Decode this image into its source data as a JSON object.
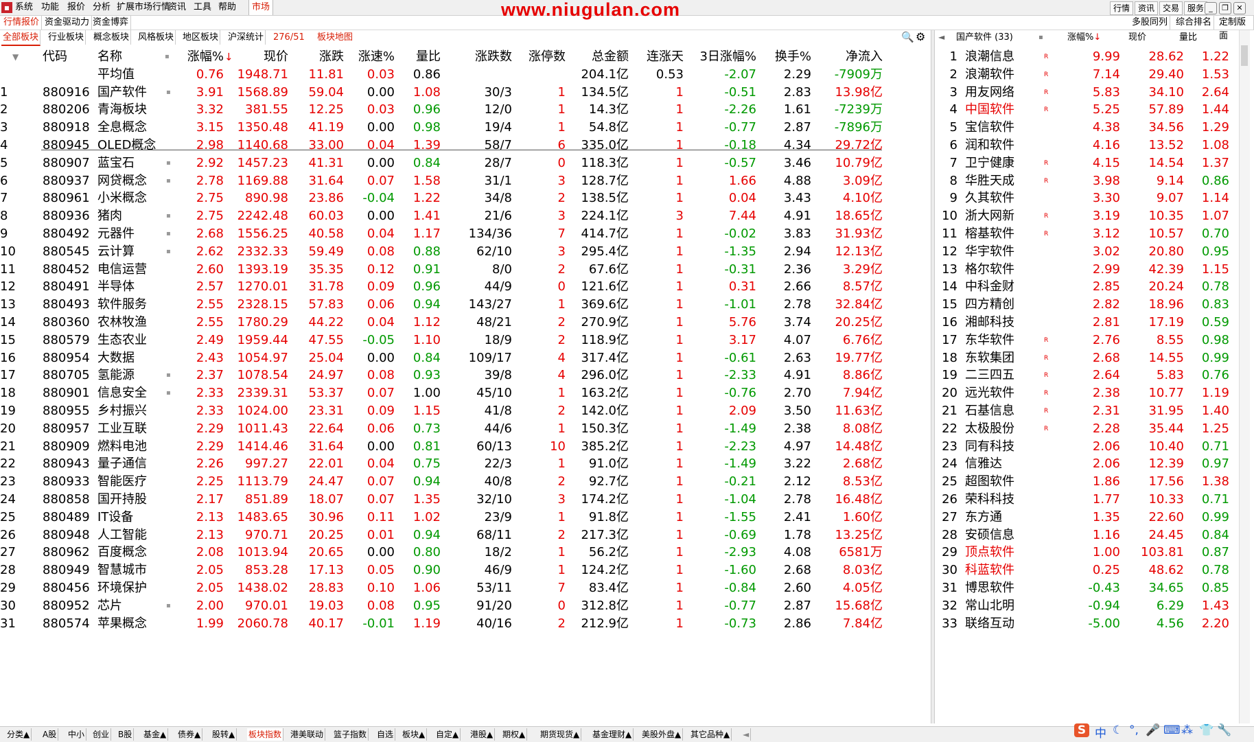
{
  "menu": [
    "系统",
    "功能",
    "报价",
    "分析",
    "扩展市场行情",
    "资讯",
    "工具",
    "帮助"
  ],
  "menu_active": "市场",
  "watermark": "www.niugulan.com",
  "top_right": [
    "行情",
    "资讯",
    "交易",
    "服务"
  ],
  "tabs1": [
    "行情报价",
    "资金驱动力",
    "资金博弈"
  ],
  "tabs1_right": [
    "多股同列",
    "综合排名",
    "定制版面"
  ],
  "tabs2": [
    "全部板块",
    "行业板块",
    "概念板块",
    "风格板块",
    "地区板块",
    "沪深统计"
  ],
  "tabs2_count": "276/51",
  "tabs2_map": "板块地图",
  "columns": [
    "代码",
    "名称",
    "涨幅%",
    "现价",
    "涨跌",
    "涨速%",
    "量比",
    "涨跌数",
    "涨停数",
    "总金额",
    "连涨天",
    "3日涨幅%",
    "换手%",
    "净流入"
  ],
  "sort_marker": "↓",
  "avg": [
    "平均值",
    "0.76",
    "1948.71",
    "11.81",
    "0.03",
    "0.86",
    "",
    "",
    "204.1亿",
    "0.53",
    "-2.07",
    "2.29",
    "-7909万"
  ],
  "rows": [
    [
      "1",
      "880916",
      "国产软件",
      "3.91",
      "1568.89",
      "59.04",
      "0.00",
      "1.08",
      "30/3",
      "1",
      "134.5亿",
      "1",
      "-0.51",
      "2.83",
      "13.98亿"
    ],
    [
      "2",
      "880206",
      "青海板块",
      "3.32",
      "381.55",
      "12.25",
      "0.03",
      "0.96",
      "12/0",
      "1",
      "14.3亿",
      "1",
      "-2.26",
      "1.61",
      "-7239万"
    ],
    [
      "3",
      "880918",
      "全息概念",
      "3.15",
      "1350.48",
      "41.19",
      "0.00",
      "0.98",
      "19/4",
      "1",
      "54.8亿",
      "1",
      "-0.77",
      "2.87",
      "-7896万"
    ],
    [
      "4",
      "880945",
      "OLED概念",
      "2.98",
      "1140.68",
      "33.00",
      "0.04",
      "1.39",
      "58/7",
      "6",
      "335.0亿",
      "1",
      "-0.18",
      "4.34",
      "29.72亿"
    ],
    [
      "5",
      "880907",
      "蓝宝石",
      "2.92",
      "1457.23",
      "41.31",
      "0.00",
      "0.84",
      "28/7",
      "0",
      "118.3亿",
      "1",
      "-0.57",
      "3.46",
      "10.79亿"
    ],
    [
      "6",
      "880937",
      "网贷概念",
      "2.78",
      "1169.88",
      "31.64",
      "0.07",
      "1.58",
      "31/1",
      "3",
      "128.7亿",
      "1",
      "1.66",
      "4.88",
      "3.09亿"
    ],
    [
      "7",
      "880961",
      "小米概念",
      "2.75",
      "890.98",
      "23.86",
      "-0.04",
      "1.22",
      "34/8",
      "2",
      "138.5亿",
      "1",
      "0.04",
      "3.43",
      "4.10亿"
    ],
    [
      "8",
      "880936",
      "猪肉",
      "2.75",
      "2242.48",
      "60.03",
      "0.00",
      "1.41",
      "21/6",
      "3",
      "224.1亿",
      "3",
      "7.44",
      "4.91",
      "18.65亿"
    ],
    [
      "9",
      "880492",
      "元器件",
      "2.68",
      "1556.25",
      "40.58",
      "0.04",
      "1.17",
      "134/36",
      "7",
      "414.7亿",
      "1",
      "-0.02",
      "3.83",
      "31.93亿"
    ],
    [
      "10",
      "880545",
      "云计算",
      "2.62",
      "2332.33",
      "59.49",
      "0.08",
      "0.88",
      "62/10",
      "3",
      "295.4亿",
      "1",
      "-1.35",
      "2.94",
      "12.13亿"
    ],
    [
      "11",
      "880452",
      "电信运营",
      "2.60",
      "1393.19",
      "35.35",
      "0.12",
      "0.91",
      "8/0",
      "2",
      "67.6亿",
      "1",
      "-0.31",
      "2.36",
      "3.29亿"
    ],
    [
      "12",
      "880491",
      "半导体",
      "2.57",
      "1270.01",
      "31.78",
      "0.09",
      "0.96",
      "44/9",
      "0",
      "121.6亿",
      "1",
      "0.31",
      "2.66",
      "8.57亿"
    ],
    [
      "13",
      "880493",
      "软件服务",
      "2.55",
      "2328.15",
      "57.83",
      "0.06",
      "0.94",
      "143/27",
      "1",
      "369.6亿",
      "1",
      "-1.01",
      "2.78",
      "32.84亿"
    ],
    [
      "14",
      "880360",
      "农林牧渔",
      "2.55",
      "1780.29",
      "44.22",
      "0.04",
      "1.12",
      "48/21",
      "2",
      "270.9亿",
      "1",
      "5.76",
      "3.74",
      "20.25亿"
    ],
    [
      "15",
      "880579",
      "生态农业",
      "2.49",
      "1959.44",
      "47.55",
      "-0.05",
      "1.10",
      "18/9",
      "2",
      "118.9亿",
      "1",
      "3.17",
      "4.07",
      "6.76亿"
    ],
    [
      "16",
      "880954",
      "大数据",
      "2.43",
      "1054.97",
      "25.04",
      "0.00",
      "0.84",
      "109/17",
      "4",
      "317.4亿",
      "1",
      "-0.61",
      "2.63",
      "19.77亿"
    ],
    [
      "17",
      "880705",
      "氢能源",
      "2.37",
      "1078.54",
      "24.97",
      "0.08",
      "0.93",
      "39/8",
      "4",
      "296.0亿",
      "1",
      "-2.33",
      "4.91",
      "8.86亿"
    ],
    [
      "18",
      "880901",
      "信息安全",
      "2.33",
      "2339.31",
      "53.37",
      "0.07",
      "1.00",
      "45/10",
      "1",
      "163.2亿",
      "1",
      "-0.76",
      "2.70",
      "7.94亿"
    ],
    [
      "19",
      "880955",
      "乡村振兴",
      "2.33",
      "1024.00",
      "23.31",
      "0.09",
      "1.15",
      "41/8",
      "2",
      "142.0亿",
      "1",
      "2.09",
      "3.50",
      "11.63亿"
    ],
    [
      "20",
      "880957",
      "工业互联",
      "2.29",
      "1011.43",
      "22.64",
      "0.06",
      "0.73",
      "44/6",
      "1",
      "150.3亿",
      "1",
      "-1.49",
      "2.38",
      "8.08亿"
    ],
    [
      "21",
      "880909",
      "燃料电池",
      "2.29",
      "1414.46",
      "31.64",
      "0.00",
      "0.81",
      "60/13",
      "10",
      "385.2亿",
      "1",
      "-2.23",
      "4.97",
      "14.48亿"
    ],
    [
      "22",
      "880943",
      "量子通信",
      "2.26",
      "997.27",
      "22.01",
      "0.04",
      "0.75",
      "22/3",
      "1",
      "91.0亿",
      "1",
      "-1.49",
      "3.22",
      "2.68亿"
    ],
    [
      "23",
      "880933",
      "智能医疗",
      "2.25",
      "1113.79",
      "24.47",
      "0.07",
      "0.94",
      "40/8",
      "2",
      "92.7亿",
      "1",
      "-0.21",
      "2.12",
      "8.53亿"
    ],
    [
      "24",
      "880858",
      "国开持股",
      "2.17",
      "851.89",
      "18.07",
      "0.07",
      "1.35",
      "32/10",
      "3",
      "174.2亿",
      "1",
      "-1.04",
      "2.78",
      "16.48亿"
    ],
    [
      "25",
      "880489",
      "IT设备",
      "2.13",
      "1483.65",
      "30.96",
      "0.11",
      "1.02",
      "23/9",
      "1",
      "91.8亿",
      "1",
      "-1.55",
      "2.41",
      "1.60亿"
    ],
    [
      "26",
      "880948",
      "人工智能",
      "2.13",
      "970.71",
      "20.25",
      "0.01",
      "0.94",
      "68/11",
      "2",
      "217.3亿",
      "1",
      "-0.69",
      "1.78",
      "13.25亿"
    ],
    [
      "27",
      "880962",
      "百度概念",
      "2.08",
      "1013.94",
      "20.65",
      "0.00",
      "0.80",
      "18/2",
      "1",
      "56.2亿",
      "1",
      "-2.93",
      "4.08",
      "6581万"
    ],
    [
      "28",
      "880949",
      "智慧城市",
      "2.05",
      "853.28",
      "17.13",
      "0.05",
      "0.90",
      "46/9",
      "1",
      "124.2亿",
      "1",
      "-1.60",
      "2.68",
      "8.03亿"
    ],
    [
      "29",
      "880456",
      "环境保护",
      "2.05",
      "1438.02",
      "28.83",
      "0.10",
      "1.06",
      "53/11",
      "7",
      "83.4亿",
      "1",
      "-0.84",
      "2.60",
      "4.05亿"
    ],
    [
      "30",
      "880952",
      "芯片",
      "2.00",
      "970.01",
      "19.03",
      "0.08",
      "0.95",
      "91/20",
      "0",
      "312.8亿",
      "1",
      "-0.77",
      "2.87",
      "15.68亿"
    ],
    [
      "31",
      "880574",
      "苹果概念",
      "1.99",
      "2060.78",
      "40.17",
      "-0.01",
      "1.19",
      "40/16",
      "2",
      "212.9亿",
      "1",
      "-0.73",
      "2.86",
      "7.84亿"
    ]
  ],
  "side": {
    "title": "国产软件 (33)",
    "columns": [
      "涨幅%",
      "现价",
      "量比"
    ],
    "rows": [
      [
        "1",
        "浪潮信息",
        "R",
        "9.99",
        "28.62",
        "1.22"
      ],
      [
        "2",
        "浪潮软件",
        "R",
        "7.14",
        "29.40",
        "1.53"
      ],
      [
        "3",
        "用友网络",
        "R",
        "5.83",
        "34.10",
        "2.64"
      ],
      [
        "4",
        "中国软件",
        "R",
        "5.25",
        "57.89",
        "1.44"
      ],
      [
        "5",
        "宝信软件",
        "",
        "4.38",
        "34.56",
        "1.29"
      ],
      [
        "6",
        "润和软件",
        "",
        "4.16",
        "13.52",
        "1.08"
      ],
      [
        "7",
        "卫宁健康",
        "R",
        "4.15",
        "14.54",
        "1.37"
      ],
      [
        "8",
        "华胜天成",
        "R",
        "3.98",
        "9.14",
        "0.86"
      ],
      [
        "9",
        "久其软件",
        "",
        "3.30",
        "9.07",
        "1.14"
      ],
      [
        "10",
        "浙大网新",
        "R",
        "3.19",
        "10.35",
        "1.07"
      ],
      [
        "11",
        "榕基软件",
        "R",
        "3.12",
        "10.57",
        "0.70"
      ],
      [
        "12",
        "华宇软件",
        "",
        "3.02",
        "20.80",
        "0.95"
      ],
      [
        "13",
        "格尔软件",
        "",
        "2.99",
        "42.39",
        "1.15"
      ],
      [
        "14",
        "中科金财",
        "",
        "2.85",
        "20.24",
        "0.78"
      ],
      [
        "15",
        "四方精创",
        "",
        "2.82",
        "18.96",
        "0.83"
      ],
      [
        "16",
        "湘邮科技",
        "",
        "2.81",
        "17.19",
        "0.59"
      ],
      [
        "17",
        "东华软件",
        "R",
        "2.76",
        "8.55",
        "0.98"
      ],
      [
        "18",
        "东软集团",
        "R",
        "2.68",
        "14.55",
        "0.99"
      ],
      [
        "19",
        "二三四五",
        "R",
        "2.64",
        "5.83",
        "0.76"
      ],
      [
        "20",
        "远光软件",
        "R",
        "2.38",
        "10.77",
        "1.19"
      ],
      [
        "21",
        "石基信息",
        "R",
        "2.31",
        "31.95",
        "1.40"
      ],
      [
        "22",
        "太极股份",
        "R",
        "2.28",
        "35.44",
        "1.25"
      ],
      [
        "23",
        "同有科技",
        "",
        "2.06",
        "10.40",
        "0.71"
      ],
      [
        "24",
        "信雅达",
        "",
        "2.06",
        "12.39",
        "0.97"
      ],
      [
        "25",
        "超图软件",
        "",
        "1.86",
        "17.56",
        "1.38"
      ],
      [
        "26",
        "荣科科技",
        "",
        "1.77",
        "10.33",
        "0.71"
      ],
      [
        "27",
        "东方通",
        "",
        "1.35",
        "22.60",
        "0.99"
      ],
      [
        "28",
        "安硕信息",
        "",
        "1.16",
        "24.45",
        "0.84"
      ],
      [
        "29",
        "顶点软件",
        "",
        "1.00",
        "103.81",
        "0.87"
      ],
      [
        "30",
        "科蓝软件",
        "",
        "0.25",
        "48.62",
        "0.78"
      ],
      [
        "31",
        "博思软件",
        "",
        "-0.43",
        "34.65",
        "0.85"
      ],
      [
        "32",
        "常山北明",
        "",
        "-0.94",
        "6.29",
        "1.43"
      ],
      [
        "33",
        "联络互动",
        "",
        "-5.00",
        "4.56",
        "2.20"
      ]
    ]
  },
  "bottom_tabs": [
    "分类▲",
    "A股",
    "中小",
    "创业",
    "B股",
    "基金▲",
    "债券▲",
    "股转▲",
    "板块指数",
    "港美联动",
    "篮子指数",
    "自选",
    "板块▲",
    "自定▲",
    "港股▲",
    "期权▲",
    "期货现货▲",
    "基金理财▲",
    "美股外盘▲",
    "其它品种▲"
  ],
  "bottom_active": "板块指数",
  "ime": "中",
  "colors": {
    "up": "#e60000",
    "down": "#009900",
    "accent": "#d81e06"
  }
}
